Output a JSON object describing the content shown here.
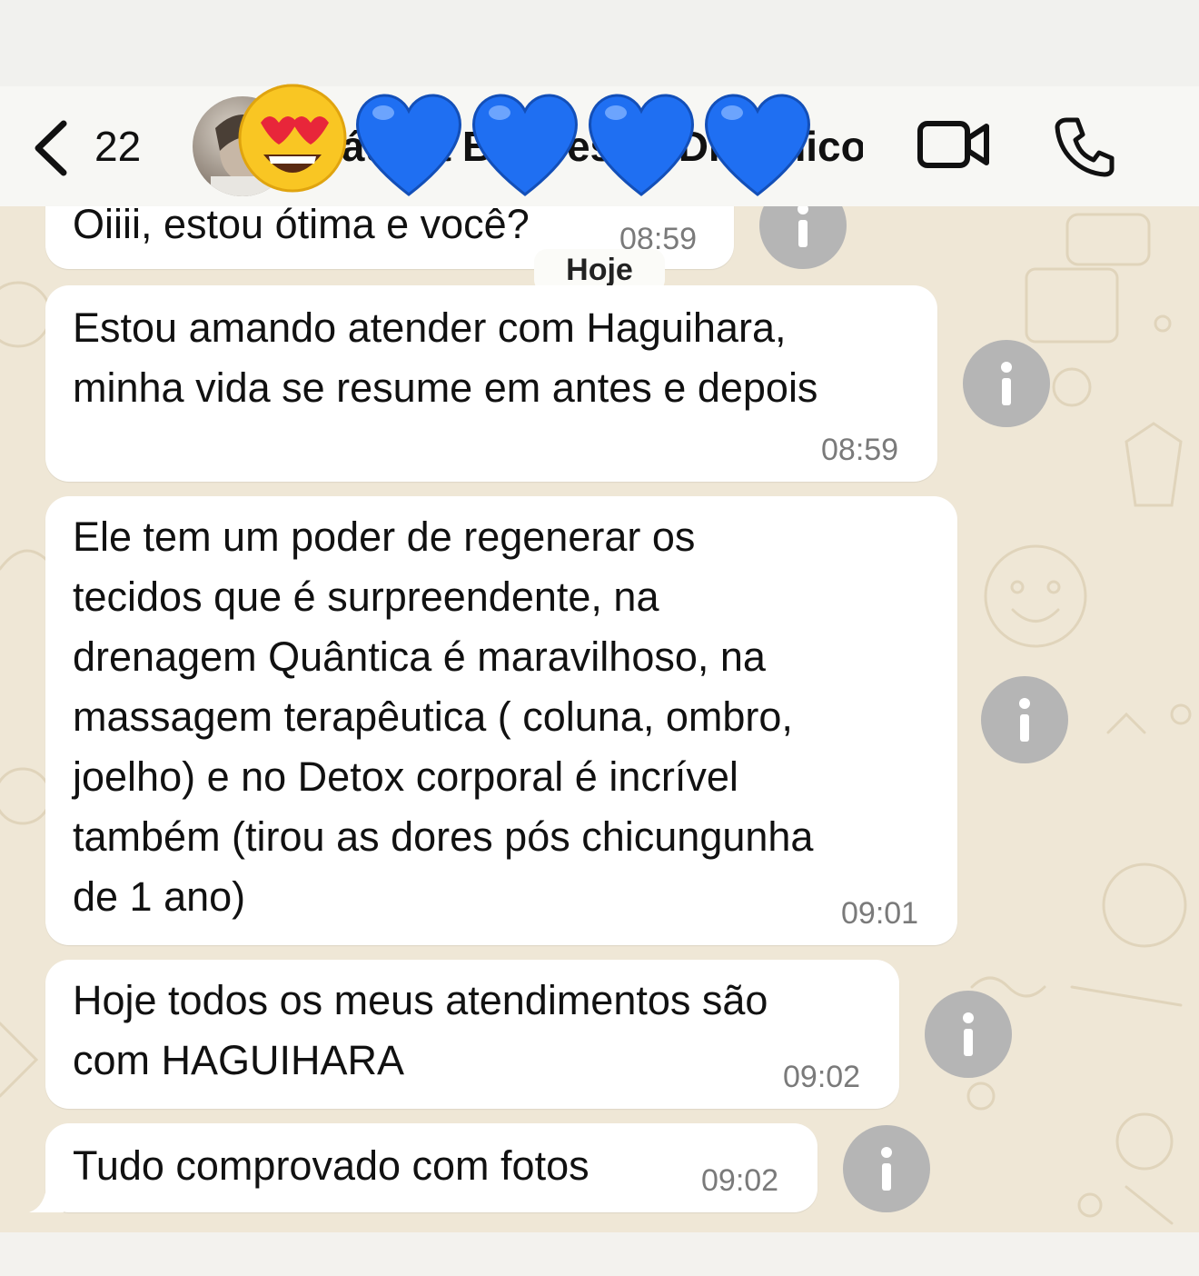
{
  "header": {
    "unread_count": "22",
    "contact_name": "Cláudia Bem-estar Dinâmico B...c...",
    "contact_emojis": [
      "😍",
      "💙",
      "💙",
      "💙",
      "💙"
    ],
    "back_icon": "chevron-left-icon",
    "video_icon": "video-camera-icon",
    "call_icon": "phone-icon"
  },
  "chat": {
    "day_separator": "Hoje",
    "messages": [
      {
        "text_lines": [
          "Oiiii, estou ótima e você?"
        ],
        "time": "08:59"
      },
      {
        "text_lines": [
          "Estou amando atender com Haguihara,",
          "minha vida se resume em antes e depois"
        ],
        "time": "08:59"
      },
      {
        "text_lines": [
          "Ele tem um poder de regenerar os",
          "tecidos que é surpreendente, na",
          "drenagem Quântica é maravilhoso, na",
          "massagem terapêutica ( coluna, ombro,",
          "joelho) e no Detox corporal é incrível",
          "também (tirou as dores pós chicungunha",
          "de 1 ano)"
        ],
        "time": "09:01"
      },
      {
        "text_lines": [
          "Hoje todos os meus atendimentos são",
          "com HAGUIHARA"
        ],
        "time": "09:02"
      },
      {
        "text_lines": [
          "Tudo comprovado com fotos"
        ],
        "time": "09:02"
      }
    ],
    "info_icon": "info-icon"
  },
  "colors": {
    "chat_background": "#efe7d6",
    "bubble": "#ffffff",
    "info_button": "#b5b5b5",
    "heart": "#1f6ff2"
  }
}
